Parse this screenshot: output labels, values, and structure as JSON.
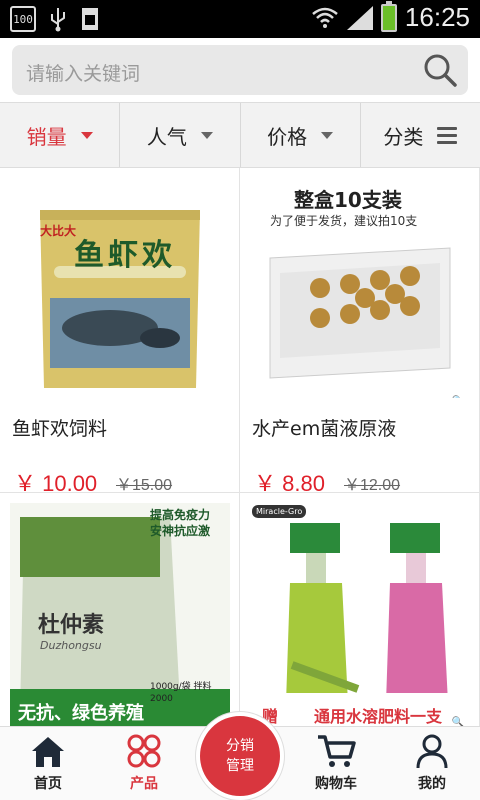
{
  "status_bar": {
    "left_icons": [
      "100",
      "usb-icon",
      "sim-icon"
    ],
    "time": "16:25",
    "battery_color": "#6bbf2a"
  },
  "search": {
    "placeholder": "请输入关键词"
  },
  "filters": [
    {
      "label": "销量",
      "active": true,
      "icon": "caret-down-icon"
    },
    {
      "label": "人气",
      "active": false,
      "icon": "caret-down-icon"
    },
    {
      "label": "价格",
      "active": false,
      "icon": "caret-down-icon"
    },
    {
      "label": "分类",
      "active": false,
      "icon": "menu-icon"
    }
  ],
  "products": [
    {
      "name": "鱼虾欢饲料",
      "price": "￥ 10.00",
      "old_price": "￥15.00",
      "image_text": "鱼虾欢",
      "brand_text": "大比大"
    },
    {
      "name": "水产em菌液原液",
      "price": "￥ 8.80",
      "old_price": "￥12.00",
      "image_title": "整盒10支装",
      "image_subtitle": "为了便于发货，建议拍10支"
    },
    {
      "name": "",
      "price": "",
      "old_price": "",
      "image_banner": "提高免疫力 安神抗应激",
      "image_text": "杜仲素",
      "image_sub": "Duzhongsu",
      "image_footer": "无抗、绿色养殖",
      "image_weight": "1000g/袋 拌料2000"
    },
    {
      "name": "",
      "price": "",
      "old_price": "",
      "image_brand": "Miracle-Gro",
      "image_footer_left": "赠",
      "image_footer": "通用水溶肥料一支"
    }
  ],
  "bottom_nav": [
    {
      "label": "首页",
      "icon": "home-icon",
      "active": false
    },
    {
      "label": "产品",
      "icon": "products-icon",
      "active": true
    },
    {
      "label": "购物车",
      "icon": "cart-icon",
      "active": false
    },
    {
      "label": "我的",
      "icon": "user-icon",
      "active": false
    }
  ],
  "center_button": {
    "line1": "分销",
    "line2": "管理"
  },
  "colors": {
    "accent": "#d9363e",
    "price": "#e0202a"
  }
}
